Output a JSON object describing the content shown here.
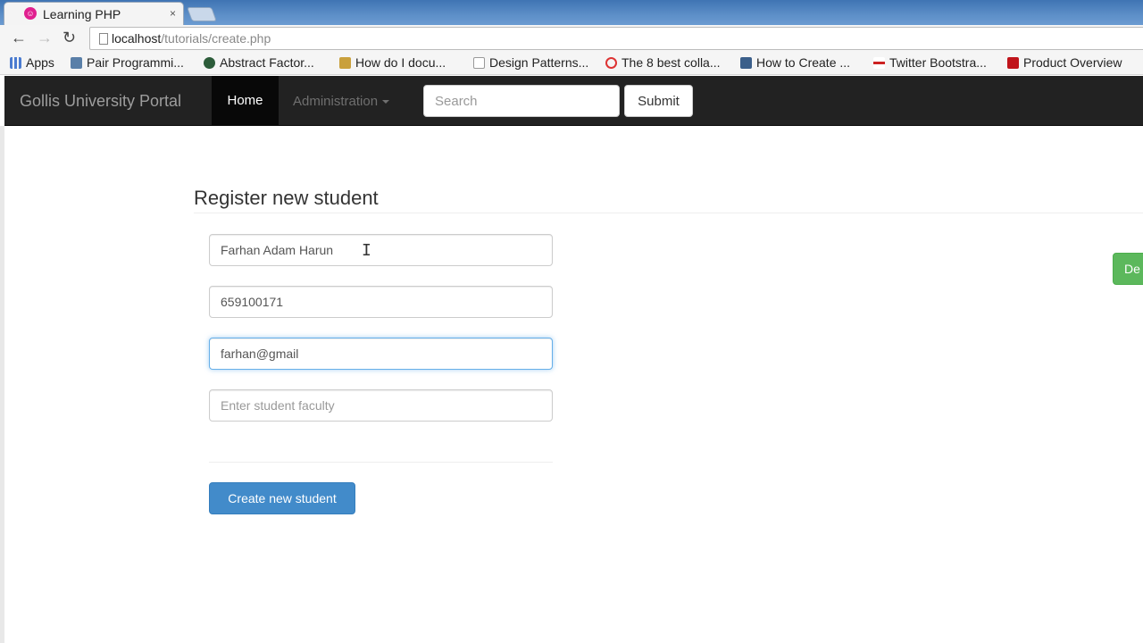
{
  "browser": {
    "tab_title": "Learning PHP",
    "tab_close": "×",
    "url_host": "localhost",
    "url_path": "/tutorials/create.php",
    "bookmarks": [
      {
        "label": "Apps",
        "icon": "apps-grid-icon",
        "color": "#4a7bd0"
      },
      {
        "label": "Pair Programmi...",
        "icon": "pair-programming-icon",
        "color": "#5a7fa8"
      },
      {
        "label": "Abstract Factor...",
        "icon": "abstract-factory-icon",
        "color": "#2c5c3a"
      },
      {
        "label": "How do I docu...",
        "icon": "stackoverflow-icon",
        "color": "#c9a03c"
      },
      {
        "label": "Design Patterns...",
        "icon": "page-icon",
        "color": "#cfcfcf"
      },
      {
        "label": "The 8 best colla...",
        "icon": "check-circle-icon",
        "color": "#d33"
      },
      {
        "label": "How to Create ...",
        "icon": "tumblr-icon",
        "color": "#3b5f8a"
      },
      {
        "label": "Twitter Bootstra...",
        "icon": "bootstrap-icon",
        "color": "#c22"
      },
      {
        "label": "Product Overview",
        "icon": "product-icon",
        "color": "#c0141b"
      }
    ]
  },
  "navbar": {
    "brand": "Gollis University Portal",
    "home": "Home",
    "administration": "Administration",
    "search_placeholder": "Search",
    "submit": "Submit"
  },
  "form": {
    "title": "Register new student",
    "name_value": "Farhan Adam Harun",
    "phone_value": "659100171",
    "email_value": "farhan@gmail",
    "faculty_placeholder": "Enter student faculty",
    "create_button": "Create new student",
    "side_button": "De"
  },
  "colors": {
    "navbar_bg": "#222222",
    "primary": "#428bca",
    "success": "#5cb85c"
  }
}
